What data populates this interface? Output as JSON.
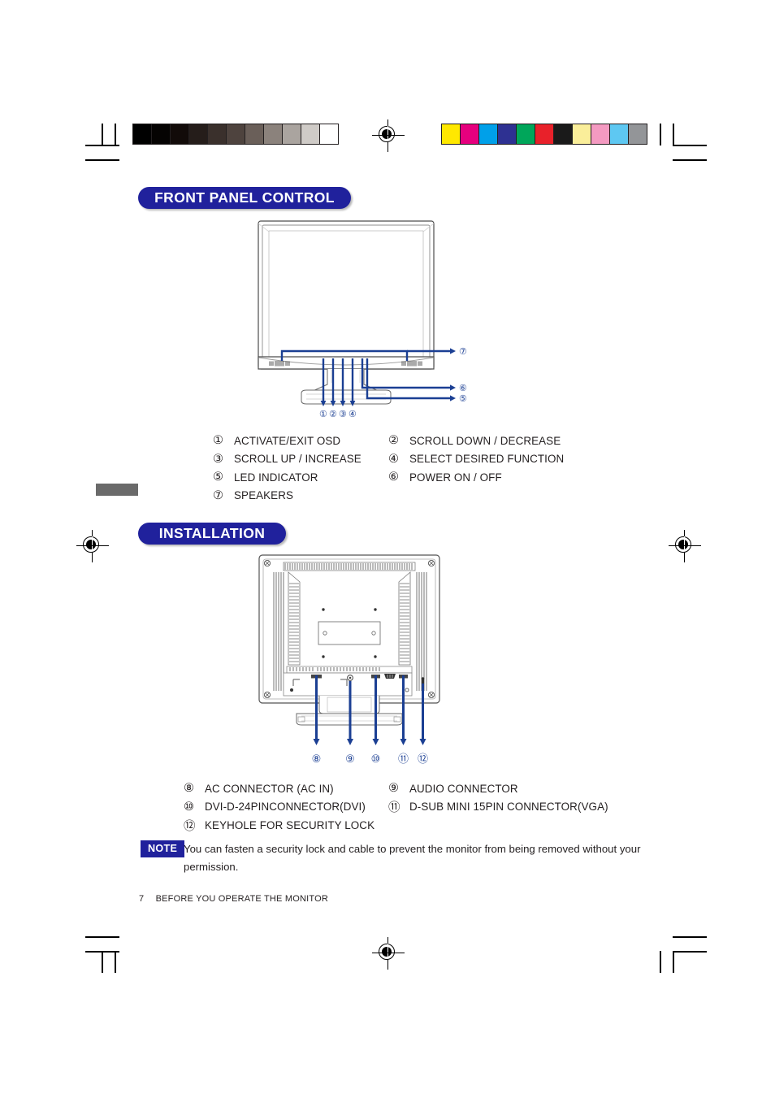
{
  "page": {
    "footer_page_number": "7",
    "footer_title": "BEFORE YOU OPERATE THE MONITOR"
  },
  "calibration": {
    "grayscale_label": "grayscale-calibration-bar",
    "grayscale_swatches": [
      "#000000",
      "#050302",
      "#120b09",
      "#251d1a",
      "#3a302c",
      "#4e433e",
      "#6a5f59",
      "#8b827c",
      "#aaa49f",
      "#cfcbc7",
      "#ffffff"
    ],
    "color_label": "color-calibration-bar",
    "color_swatches": [
      "#ffe800",
      "#e6007e",
      "#00a0e9",
      "#2e3192",
      "#00a65a",
      "#e8212a",
      "#1a1a1a",
      "#faee9a",
      "#f49ac1",
      "#5ec8f2",
      "#939598"
    ]
  },
  "sections": [
    {
      "id": "front-panel-control",
      "heading": "FRONT PANEL CONTROL",
      "figure_name": "monitor-front-view-diagram",
      "callouts": [
        "1",
        "2",
        "3",
        "4",
        "5",
        "6",
        "7"
      ],
      "legend": [
        {
          "num": "①",
          "text": "ACTIVATE/EXIT OSD"
        },
        {
          "num": "②",
          "text": "SCROLL DOWN / DECREASE"
        },
        {
          "num": "③",
          "text": "SCROLL UP / INCREASE"
        },
        {
          "num": "④",
          "text": "SELECT DESIRED FUNCTION"
        },
        {
          "num": "⑤",
          "text": "LED INDICATOR"
        },
        {
          "num": "⑥",
          "text": " POWER ON / OFF"
        },
        {
          "num": "⑦",
          "text": "SPEAKERS"
        }
      ]
    },
    {
      "id": "installation",
      "heading": "INSTALLATION",
      "figure_name": "monitor-rear-view-diagram",
      "callouts": [
        "8",
        "9",
        "10",
        "11",
        "12"
      ],
      "legend": [
        {
          "num": "⑧",
          "text": "AC CONNECTOR (AC IN)"
        },
        {
          "num": "⑨",
          "text": "AUDIO CONNECTOR"
        },
        {
          "num": "⑩",
          "text": "DVI-D-24PINCONNECTOR(DVI)"
        },
        {
          "num": "⑪",
          "text": "D-SUB MINI 15PIN CONNECTOR(VGA)"
        },
        {
          "num": "⑫",
          "text": "KEYHOLE FOR SECURITY LOCK"
        }
      ],
      "note": {
        "badge": "NOTE",
        "text": "You can fasten a security lock and cable to prevent the monitor from being removed without your permission."
      }
    }
  ],
  "figure_callout_labels": {
    "front": [
      "①",
      "②",
      "③",
      "④",
      "⑤",
      "⑥",
      "⑦"
    ],
    "rear": [
      "⑧",
      "⑨",
      "⑩",
      "⑪",
      "⑫"
    ]
  },
  "colors": {
    "brand_blue": "#20219c",
    "callout_blue": "#1b3f93",
    "ink": "#231f20"
  }
}
